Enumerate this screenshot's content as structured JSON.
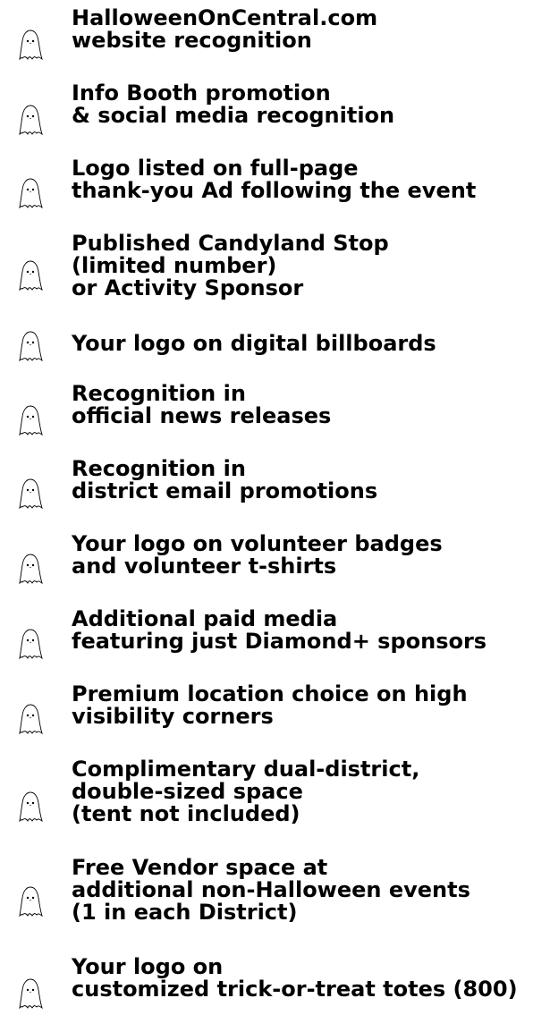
{
  "benefits": [
    {
      "icon": "ghost-icon",
      "lines": [
        "HalloweenOnCentral.com",
        "website recognition"
      ]
    },
    {
      "icon": "ghost-icon",
      "lines": [
        "Info Booth promotion",
        "& social media recognition"
      ]
    },
    {
      "icon": "ghost-icon",
      "lines": [
        "Logo listed on full-page",
        "thank-you Ad following the event"
      ]
    },
    {
      "icon": "ghost-icon",
      "lines": [
        "Published Candyland Stop",
        "(limited number)",
        "or Activity Sponsor"
      ]
    },
    {
      "icon": "ghost-icon",
      "lines": [
        "Your logo on digital billboards"
      ]
    },
    {
      "icon": "ghost-icon",
      "lines": [
        "Recognition in",
        "official news releases"
      ]
    },
    {
      "icon": "ghost-icon",
      "lines": [
        "Recognition in",
        "district email promotions"
      ]
    },
    {
      "icon": "ghost-icon",
      "lines": [
        "Your logo on volunteer badges",
        "and volunteer t-shirts"
      ]
    },
    {
      "icon": "ghost-icon",
      "lines": [
        "Additional paid media",
        "featuring just Diamond+ sponsors"
      ]
    },
    {
      "icon": "ghost-icon",
      "lines": [
        "Premium location choice on high",
        "visibility corners"
      ]
    },
    {
      "icon": "ghost-icon",
      "lines": [
        "Complimentary dual-district,",
        "double-sized space",
        "(tent not included)"
      ]
    },
    {
      "icon": "ghost-icon",
      "lines": [
        "Free Vendor space at",
        "additional non-Halloween events",
        "(1 in each District)"
      ]
    },
    {
      "icon": "ghost-icon",
      "lines": [
        "Your logo on",
        "customized trick-or-treat totes (800)"
      ]
    }
  ]
}
